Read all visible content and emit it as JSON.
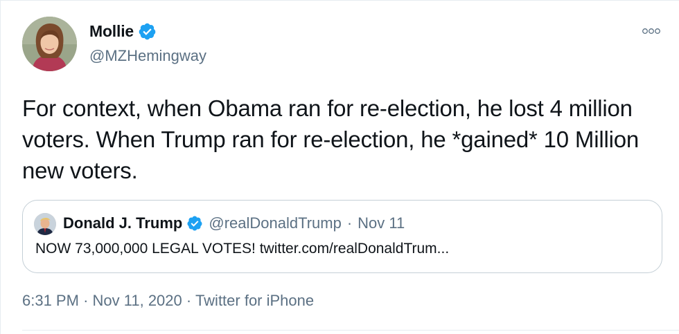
{
  "author": {
    "display_name": "Mollie",
    "handle": "@MZHemingway",
    "verified": true,
    "avatar_icon": "profile-photo"
  },
  "tweet": {
    "text": "For context, when Obama ran for re-election, he lost 4 million voters. When Trump ran for re-election, he *gained* 10 Million new voters.",
    "time": "6:31 PM",
    "date": "Nov 11, 2020",
    "source": "Twitter for iPhone",
    "separator": "·"
  },
  "quoted_tweet": {
    "display_name": "Donald J. Trump",
    "handle": "@realDonaldTrump",
    "separator": "·",
    "date": "Nov 11",
    "verified": true,
    "text": "NOW 73,000,000 LEGAL VOTES! twitter.com/realDonaldTrum..."
  },
  "icons": {
    "verified": "verified-badge-icon",
    "more": "more-options-icon"
  },
  "colors": {
    "verified_blue": "#1da1f2",
    "secondary_text": "#5b7083",
    "border": "#c4cfd6"
  }
}
